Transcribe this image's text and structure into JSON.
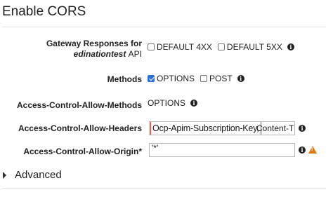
{
  "title": "Enable CORS",
  "gateway_responses": {
    "label_line1": "Gateway Responses for",
    "api_name": "edinationtest",
    "api_suffix": "API",
    "option1": "DEFAULT 4XX",
    "option1_checked": false,
    "option2": "DEFAULT 5XX",
    "option2_checked": false
  },
  "methods": {
    "label": "Methods",
    "option1": "OPTIONS",
    "option1_checked": true,
    "option2": "POST",
    "option2_checked": false
  },
  "allow_methods": {
    "label": "Access-Control-Allow-Methods",
    "value": "OPTIONS"
  },
  "allow_headers": {
    "label": "Access-Control-Allow-Headers",
    "highlighted_value": "Ocp-Apim-Subscription-Key,",
    "rest_value": "Content-T"
  },
  "allow_origin": {
    "label": "Access-Control-Allow-Origin*",
    "value": "'*'"
  },
  "advanced": {
    "label": "Advanced"
  },
  "icons": {
    "info": "info-icon",
    "warning": "warning-icon",
    "expand": "caret-right-icon"
  },
  "colors": {
    "checkbox_checked": "#2a6ed8",
    "highlight_border": "#d32f2f",
    "warning": "#e07b10"
  }
}
